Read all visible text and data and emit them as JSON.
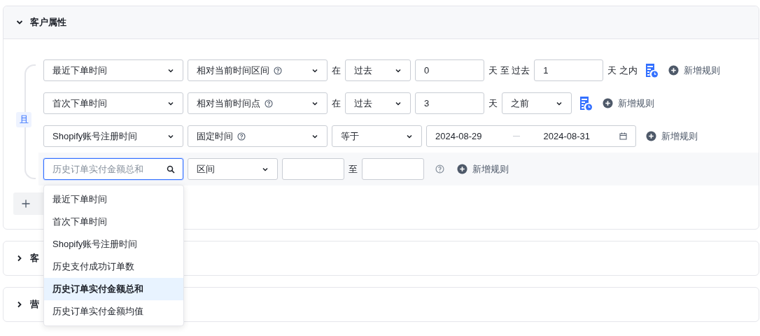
{
  "sections": [
    {
      "title": "客户属性",
      "expanded": true,
      "logic": "且",
      "add_group": true,
      "rows": [
        {
          "active": false,
          "parts": [
            {
              "kind": "select",
              "value": "最近下单时间",
              "help": false
            },
            {
              "kind": "select",
              "value": "相对当前时间区间",
              "help": true
            },
            {
              "kind": "text",
              "text": "在"
            },
            {
              "kind": "select",
              "value": "过去",
              "help": false
            },
            {
              "kind": "input",
              "value": "0"
            },
            {
              "kind": "text",
              "text": "天 至 过去"
            },
            {
              "kind": "input",
              "value": "1"
            },
            {
              "kind": "text",
              "text": "天 之内"
            },
            {
              "kind": "schedule"
            }
          ],
          "add_rule": "新增规则"
        },
        {
          "active": false,
          "parts": [
            {
              "kind": "select",
              "value": "首次下单时间",
              "help": false
            },
            {
              "kind": "select",
              "value": "相对当前时间点",
              "help": true
            },
            {
              "kind": "text",
              "text": "在"
            },
            {
              "kind": "select",
              "value": "过去",
              "help": false
            },
            {
              "kind": "input",
              "value": "3"
            },
            {
              "kind": "text",
              "text": "天"
            },
            {
              "kind": "select",
              "value": "之前",
              "help": false
            },
            {
              "kind": "schedule"
            }
          ],
          "add_rule": "新增规则"
        },
        {
          "active": false,
          "parts": [
            {
              "kind": "select",
              "value": "Shopify账号注册时间",
              "help": false
            },
            {
              "kind": "select",
              "value": "固定时间",
              "help": true
            },
            {
              "kind": "select",
              "value": "等于",
              "help": false
            },
            {
              "kind": "daterange",
              "start": "2024-08-29",
              "end": "2024-08-31"
            }
          ],
          "add_rule": "新增规则"
        },
        {
          "active": true,
          "parts": [
            {
              "kind": "search",
              "placeholder": "历史订单实付金额总和"
            },
            {
              "kind": "select",
              "value": "区间",
              "help": false
            },
            {
              "kind": "input"
            },
            {
              "kind": "text",
              "text": "至"
            },
            {
              "kind": "input"
            },
            {
              "kind": "help"
            }
          ],
          "add_rule": "新增规则"
        }
      ]
    },
    {
      "title": "客",
      "expanded": false
    },
    {
      "title": "营",
      "expanded": false
    }
  ],
  "dropdown": {
    "items": [
      {
        "label": "最近下单时间",
        "selected": false
      },
      {
        "label": "首次下单时间",
        "selected": false
      },
      {
        "label": "Shopify账号注册时间",
        "selected": false
      },
      {
        "label": "历史支付成功订单数",
        "selected": false
      },
      {
        "label": "历史订单实付金额总和",
        "selected": true
      },
      {
        "label": "历史订单实付金额均值",
        "selected": false
      }
    ]
  }
}
